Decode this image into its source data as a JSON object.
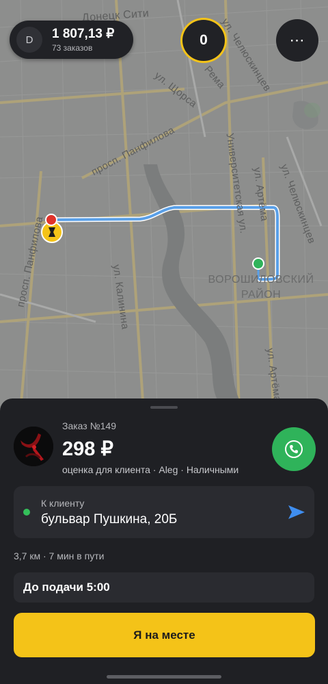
{
  "header": {
    "avatar_initial": "D",
    "earnings": "1 807,13 ₽",
    "orders_count": "73 заказов",
    "queue_counter": "0",
    "more_label": "⋯"
  },
  "map": {
    "streets": [
      {
        "key": "s1",
        "text": "Донецк Сити"
      },
      {
        "key": "s2",
        "text": "ул. Челюскинцев"
      },
      {
        "key": "s3",
        "text": "ул. Щорса"
      },
      {
        "key": "s4",
        "text": "Рема"
      },
      {
        "key": "s5",
        "text": "просп. Панфилова"
      },
      {
        "key": "s6",
        "text": "Университетская ул."
      },
      {
        "key": "s7",
        "text": "ул. Артёма"
      },
      {
        "key": "s8",
        "text": "ул. Челюскинцев"
      },
      {
        "key": "s9",
        "text": "просп. Панфилова"
      },
      {
        "key": "s10",
        "text": "ул. Калинина"
      },
      {
        "key": "s11",
        "text": "ул. Артёма"
      }
    ],
    "district": "ВОРОШИЛОВСКИЙ РАЙОН",
    "route_color": "#5aa0e8",
    "origin_color": "#e0332b",
    "destination_color": "#2fb35a"
  },
  "order": {
    "number": "Заказ №149",
    "price": "298 ₽",
    "meta": "оценка для клиента · Aleg · Наличными",
    "destination_caption": "К клиенту",
    "destination_address": "бульвар Пушкина, 20Б",
    "route_info": "3,7 км · 7 мин в пути",
    "pickup_timer": "До подачи 5:00",
    "arrived_label": "Я на месте"
  },
  "colors": {
    "accent": "#f4c318",
    "call_green": "#2fb35a",
    "nav_blue": "#3f8ef0"
  },
  "icons": {
    "call": "phone-icon",
    "navigate": "navigation-arrow-icon",
    "more": "more-dots-icon"
  }
}
